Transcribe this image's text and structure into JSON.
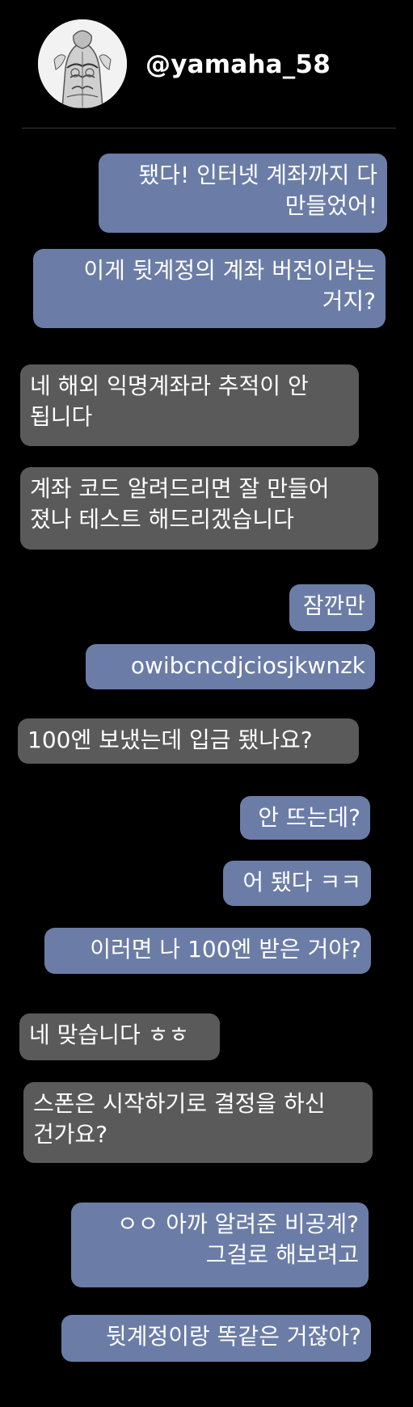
{
  "header": {
    "username": "@yamaha_58"
  },
  "colors": {
    "background": "#000000",
    "sent_bubble": "#6b7da6",
    "received_bubble": "#5a5a5a",
    "divider": "#3a3a3c"
  },
  "messages": [
    {
      "direction": "sent",
      "text": "됐다! 인터넷 계좌까지 다\n만들었어!"
    },
    {
      "direction": "sent",
      "text": "이게 뒷계정의 계좌 버전이라는\n거지?"
    },
    {
      "direction": "received",
      "text": "네 해외 익명계좌라 추적이 안\n됩니다"
    },
    {
      "direction": "received",
      "text": "계좌 코드 알려드리면 잘 만들어\n졌나 테스트 해드리겠습니다"
    },
    {
      "direction": "sent",
      "text": "잠깐만"
    },
    {
      "direction": "sent",
      "text": "owibcncdjciosjkwnzk"
    },
    {
      "direction": "received",
      "text": "100엔 보냈는데 입금 됐나요?"
    },
    {
      "direction": "sent",
      "text": "안 뜨는데?"
    },
    {
      "direction": "sent",
      "text": "어 됐다 ㅋㅋ"
    },
    {
      "direction": "sent",
      "text": "이러면 나 100엔 받은 거야?"
    },
    {
      "direction": "received",
      "text": "네 맞습니다 ㅎㅎ"
    },
    {
      "direction": "received",
      "text": "스폰은 시작하기로 결정을 하신\n건가요?"
    },
    {
      "direction": "sent",
      "text": "ㅇㅇ 아까 알려준 비공계?\n그걸로 해보려고"
    },
    {
      "direction": "sent",
      "text": "뒷계정이랑 똑같은 거잖아?"
    }
  ]
}
